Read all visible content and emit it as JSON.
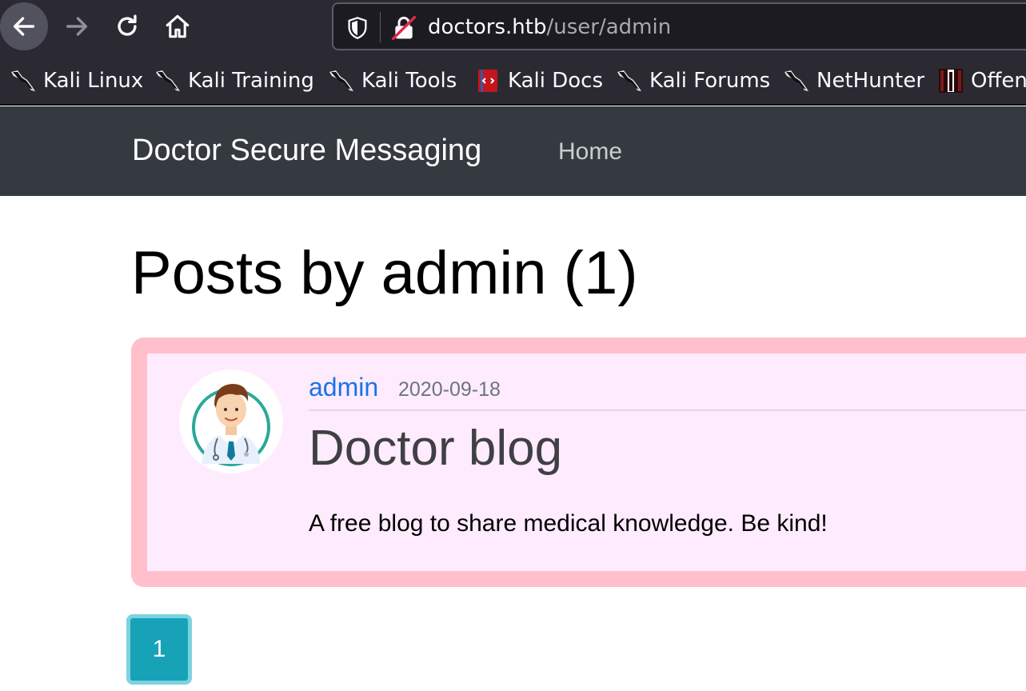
{
  "browser": {
    "url_domain": "doctors.htb",
    "url_path": "/user/admin",
    "bookmarks": [
      {
        "label": "Kali Linux",
        "icon": "kali-dragon-icon"
      },
      {
        "label": "Kali Training",
        "icon": "kali-dragon-icon"
      },
      {
        "label": "Kali Tools",
        "icon": "kali-dragon-icon"
      },
      {
        "label": "Kali Docs",
        "icon": "kali-docs-icon"
      },
      {
        "label": "Kali Forums",
        "icon": "kali-dragon-icon"
      },
      {
        "label": "NetHunter",
        "icon": "kali-dragon-icon"
      },
      {
        "label": "Offen",
        "icon": "offsec-icon"
      }
    ]
  },
  "site": {
    "brand": "Doctor Secure Messaging",
    "nav_home": "Home"
  },
  "main": {
    "title": "Posts by admin (1)",
    "post": {
      "author": "admin",
      "date": "2020-09-18",
      "title": "Doctor blog",
      "content": "A free blog to share medical knowledge. Be kind!"
    },
    "pagination": {
      "current_page": "1"
    }
  },
  "colors": {
    "navbar_bg": "#343a40",
    "card_bg": "#ffebfe",
    "card_border": "#ffc0cb",
    "author_link": "#1a73e8",
    "page_button": "#17a2b8"
  }
}
